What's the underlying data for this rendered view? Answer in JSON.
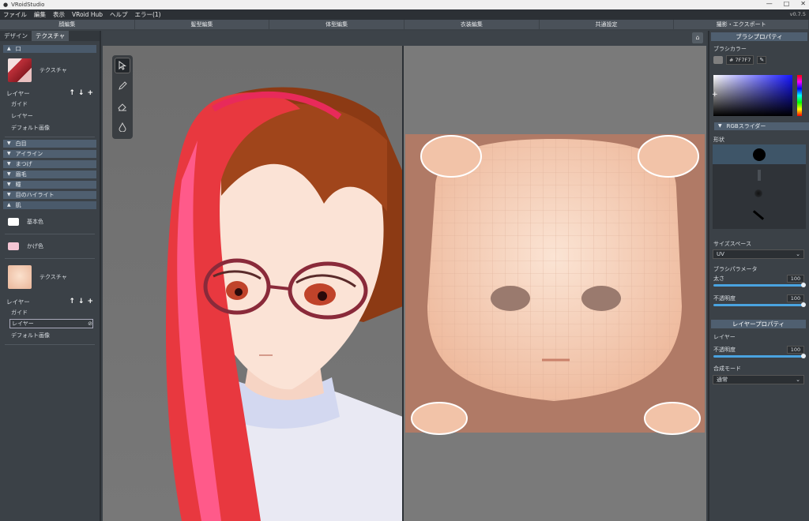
{
  "window": {
    "title": "VRoidStudio",
    "version": "v0.7.5"
  },
  "menu": [
    "ファイル",
    "編集",
    "表示",
    "VRoid Hub",
    "ヘルプ",
    "エラー(1)"
  ],
  "main_tabs": [
    "顔編集",
    "髪型編集",
    "体型編集",
    "衣装編集",
    "共通設定",
    "撮影・エクスポート"
  ],
  "left_panel": {
    "tabs": [
      "デザイン",
      "テクスチャ"
    ],
    "mouth_section": "口",
    "texture_label": "テクスチャ",
    "layer_label": "レイヤー",
    "mouth_layers": [
      "ガイド",
      "レイヤー",
      "デフォルト画像"
    ],
    "collapsed_sections": [
      "白目",
      "アイライン",
      "まつげ",
      "眉毛",
      "瞳",
      "目のハイライト"
    ],
    "skin_section": "肌",
    "base_color_label": "基本色",
    "shadow_color_label": "かげ色",
    "skin_texture_label": "テクスチャ",
    "skin_layers": [
      "ガイド",
      "レイヤー",
      "デフォルト画像"
    ]
  },
  "right_panel": {
    "brush_props_title": "ブラシプロパティ",
    "brush_color_label": "ブラシカラー",
    "hex_value": "# 7F7F7",
    "rgb_slider_label": "RGBスライダー",
    "shape_label": "形状",
    "size_space_label": "サイズスペース",
    "size_space_value": "UV",
    "brush_params_label": "ブラシパラメータ",
    "thickness_label": "太さ",
    "thickness_value": "100",
    "opacity_label": "不透明度",
    "opacity_value": "100",
    "layer_props_title": "レイヤープロパティ",
    "layer_label": "レイヤー",
    "layer_opacity_label": "不透明度",
    "layer_opacity_value": "100",
    "blend_mode_label": "合成モード",
    "blend_mode_value": "通常"
  },
  "colors": {
    "accent": "#4aa3e0",
    "panel": "#3b4147",
    "section": "#4f5f70",
    "skin": "#f3c9a8"
  }
}
